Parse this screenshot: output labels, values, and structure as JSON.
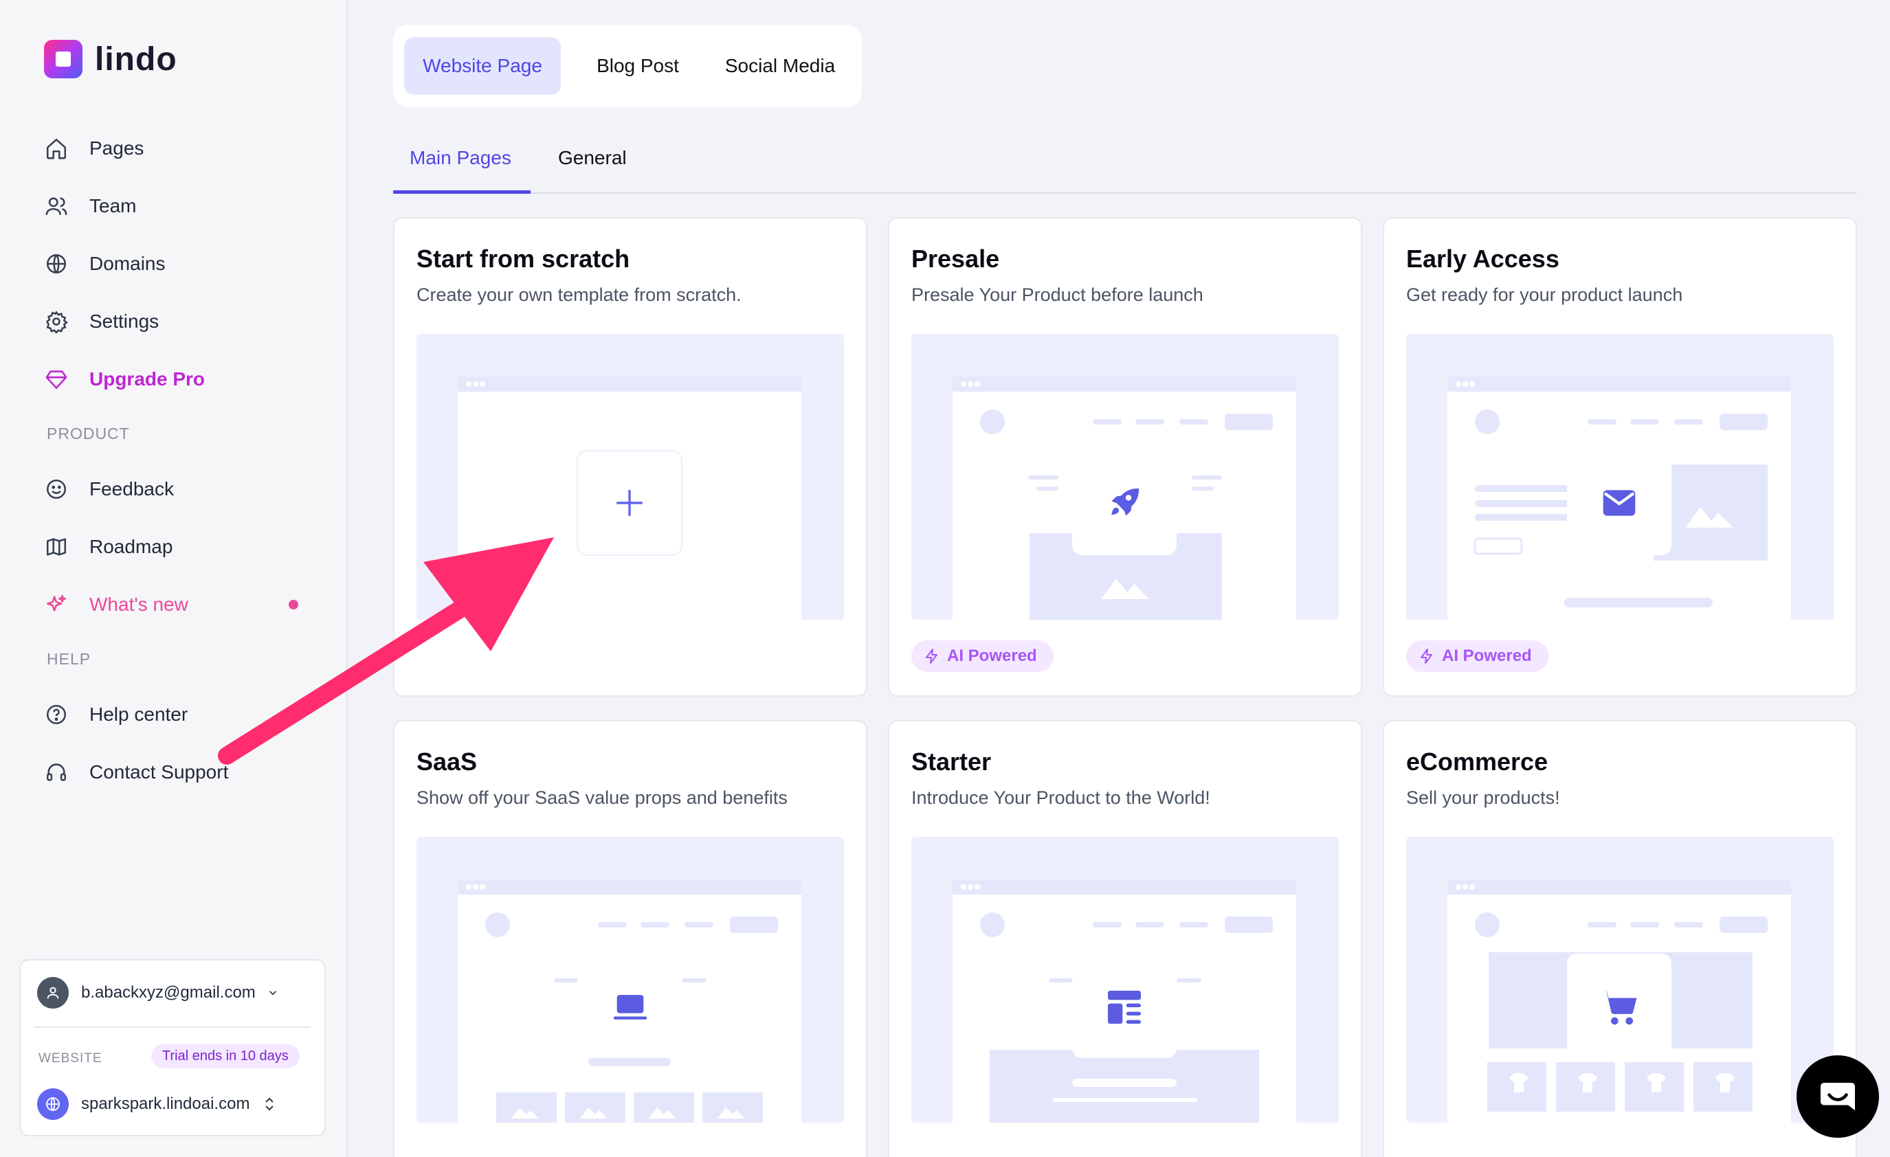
{
  "brand": {
    "name": "lindo"
  },
  "sidebar": {
    "items": [
      {
        "label": "Pages",
        "icon": "home-icon"
      },
      {
        "label": "Team",
        "icon": "users-icon"
      },
      {
        "label": "Domains",
        "icon": "globe-icon"
      },
      {
        "label": "Settings",
        "icon": "gear-icon"
      },
      {
        "label": "Upgrade Pro",
        "icon": "diamond-icon"
      }
    ],
    "product_section": "PRODUCT",
    "product_items": [
      {
        "label": "Feedback",
        "icon": "smile-icon"
      },
      {
        "label": "Roadmap",
        "icon": "map-icon"
      },
      {
        "label": "What's new",
        "icon": "sparkles-icon"
      }
    ],
    "help_section": "HELP",
    "help_items": [
      {
        "label": "Help center",
        "icon": "question-circle-icon"
      },
      {
        "label": "Contact Support",
        "icon": "headset-icon"
      }
    ],
    "account": {
      "email": "b.abackxyz@gmail.com",
      "website_label": "WEBSITE",
      "trial": "Trial ends in 10 days",
      "site": "sparkspark.lindoai.com"
    }
  },
  "type_tabs": [
    "Website Page",
    "Blog Post",
    "Social Media"
  ],
  "sub_tabs": [
    "Main Pages",
    "General"
  ],
  "ai_badge": "AI Powered",
  "templates": [
    {
      "title": "Start from scratch",
      "desc": "Create your own template from scratch.",
      "icon": "plus-icon",
      "ai": false
    },
    {
      "title": "Presale",
      "desc": "Presale Your Product before launch",
      "icon": "rocket-icon",
      "ai": true
    },
    {
      "title": "Early Access",
      "desc": "Get ready for your product launch",
      "icon": "mail-icon",
      "ai": true
    },
    {
      "title": "SaaS",
      "desc": "Show off your SaaS value props and benefits",
      "icon": "laptop-icon",
      "ai": true
    },
    {
      "title": "Starter",
      "desc": "Introduce Your Product to the World!",
      "icon": "layout-icon",
      "ai": true
    },
    {
      "title": "eCommerce",
      "desc": "Sell your products!",
      "icon": "cart-icon",
      "ai": true
    }
  ],
  "colors": {
    "accent": "#4f46e5",
    "pink": "#ec4899",
    "pro": "#c026d3",
    "annotation_arrow": "#ff2d6e"
  }
}
